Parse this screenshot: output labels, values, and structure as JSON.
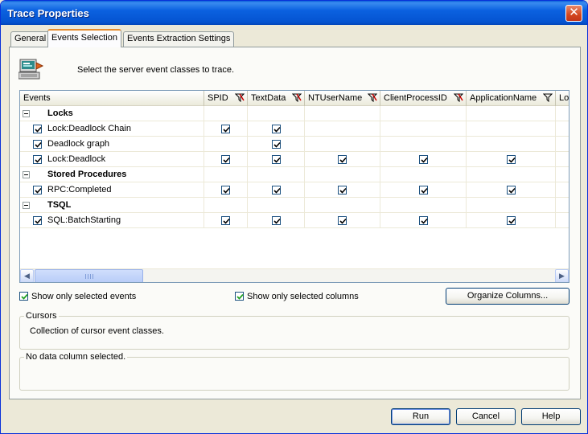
{
  "window": {
    "title": "Trace Properties",
    "close_glyph": "✕"
  },
  "tabs": [
    {
      "label": "General",
      "active": false
    },
    {
      "label": "Events Selection",
      "active": true
    },
    {
      "label": "Events Extraction Settings",
      "active": false
    }
  ],
  "instruction": "Select the server event classes to trace.",
  "grid": {
    "columns": [
      "Events",
      "SPID",
      "TextData",
      "NTUserName",
      "ClientProcessID",
      "ApplicationName",
      "Lo"
    ],
    "groups": [
      {
        "name": "Locks",
        "events": [
          {
            "name": "Lock:Deadlock Chain",
            "checked": true,
            "cols": [
              true,
              true,
              false,
              false,
              false
            ]
          },
          {
            "name": "Deadlock graph",
            "checked": true,
            "cols": [
              false,
              true,
              false,
              false,
              false
            ]
          },
          {
            "name": "Lock:Deadlock",
            "checked": true,
            "cols": [
              true,
              true,
              true,
              true,
              true
            ]
          }
        ]
      },
      {
        "name": "Stored Procedures",
        "events": [
          {
            "name": "RPC:Completed",
            "checked": true,
            "cols": [
              true,
              true,
              true,
              true,
              true
            ]
          }
        ]
      },
      {
        "name": "TSQL",
        "events": [
          {
            "name": "SQL:BatchStarting",
            "checked": true,
            "cols": [
              true,
              true,
              true,
              true,
              true
            ]
          }
        ]
      }
    ]
  },
  "options": {
    "show_selected_events": {
      "label": "Show only selected events",
      "checked": true
    },
    "show_selected_columns": {
      "label": "Show only selected columns",
      "checked": true
    },
    "organize_columns_label": "Organize Columns..."
  },
  "cursors_box": {
    "title": "Cursors",
    "description": "Collection of cursor event classes."
  },
  "data_column_box": {
    "title": "No data column selected."
  },
  "buttons": {
    "run": "Run",
    "cancel": "Cancel",
    "help": "Help"
  },
  "colors": {
    "title_bar": "#0554d1",
    "dialog_bg": "#ece9d8",
    "active_tab_accent": "#e68b2c"
  }
}
